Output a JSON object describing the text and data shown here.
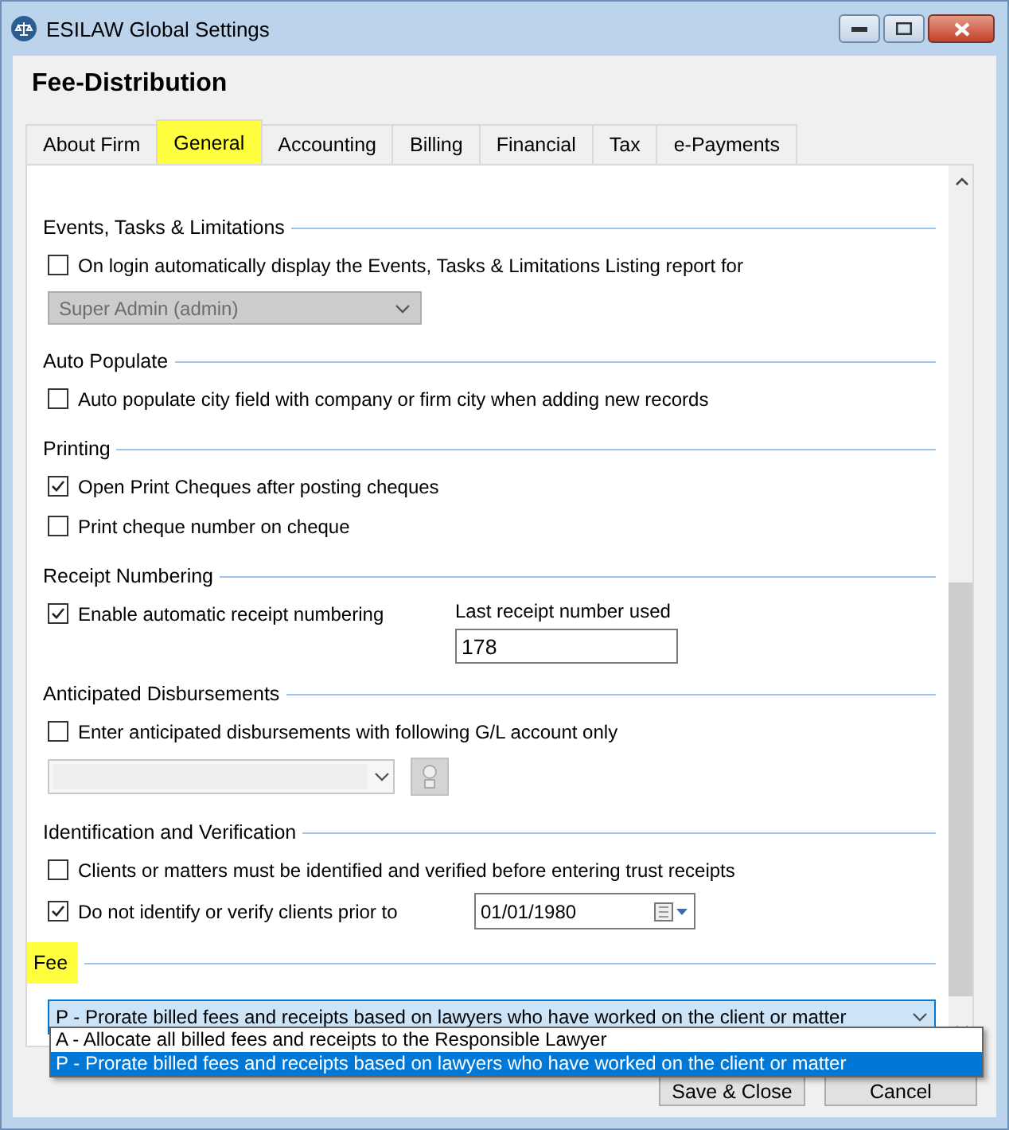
{
  "window": {
    "title": "ESILAW Global Settings"
  },
  "heading": "Fee-Distribution",
  "tabs": [
    {
      "label": "About Firm",
      "selected": false,
      "highlighted": false
    },
    {
      "label": "General",
      "selected": true,
      "highlighted": true
    },
    {
      "label": "Accounting",
      "selected": false,
      "highlighted": false
    },
    {
      "label": "Billing",
      "selected": false,
      "highlighted": false
    },
    {
      "label": "Financial",
      "selected": false,
      "highlighted": false
    },
    {
      "label": "Tax",
      "selected": false,
      "highlighted": false
    },
    {
      "label": "e-Payments",
      "selected": false,
      "highlighted": false
    }
  ],
  "sections": [
    {
      "title": "Events, Tasks & Limitations",
      "highlighted": false,
      "rows": [
        {
          "kind": "checkbox",
          "label": "On login automatically display the Events, Tasks & Limitations Listing report for",
          "checked": false
        },
        {
          "kind": "select",
          "value": "Super Admin (admin)",
          "disabled": true
        }
      ]
    },
    {
      "title": "Auto Populate",
      "highlighted": false,
      "rows": [
        {
          "kind": "checkbox",
          "label": "Auto populate city field with company or firm city when adding new records",
          "checked": false
        }
      ]
    },
    {
      "title": "Printing",
      "highlighted": false,
      "rows": [
        {
          "kind": "checkbox",
          "label": "Open Print Cheques after posting cheques",
          "checked": true
        },
        {
          "kind": "checkbox",
          "label": "Print cheque number on cheque",
          "checked": false
        }
      ]
    },
    {
      "title": "Receipt Numbering",
      "highlighted": false,
      "rows": [
        {
          "kind": "checkbox_field",
          "label": "Enable automatic receipt numbering",
          "checked": true,
          "field_label": "Last receipt number used",
          "value": "178"
        }
      ]
    },
    {
      "title": "Anticipated Disbursements",
      "highlighted": false,
      "rows": [
        {
          "kind": "checkbox",
          "label": "Enter anticipated disbursements with following G/L account only",
          "checked": false
        },
        {
          "kind": "account_select",
          "disabled": true
        }
      ]
    },
    {
      "title": "Identification and Verification",
      "highlighted": false,
      "rows": [
        {
          "kind": "checkbox",
          "label": "Clients or matters must be identified and verified before entering trust receipts",
          "checked": false
        },
        {
          "kind": "checkbox_date",
          "label": "Do not identify or verify clients prior to",
          "checked": true,
          "value": "01/01/1980"
        }
      ]
    },
    {
      "title": "Fee",
      "highlighted": true,
      "rows": [
        {
          "kind": "combo",
          "value": "P - Prorate billed fees and receipts based on lawyers who have worked on the client or matter",
          "open": true,
          "options": [
            {
              "label": "A - Allocate all billed fees and receipts to the Responsible Lawyer",
              "selected": false
            },
            {
              "label": "P - Prorate billed fees and receipts based on lawyers who have worked on the client or matter",
              "selected": true
            }
          ]
        }
      ]
    }
  ],
  "buttons": [
    {
      "label": "Save & Close"
    },
    {
      "label": "Cancel"
    }
  ]
}
